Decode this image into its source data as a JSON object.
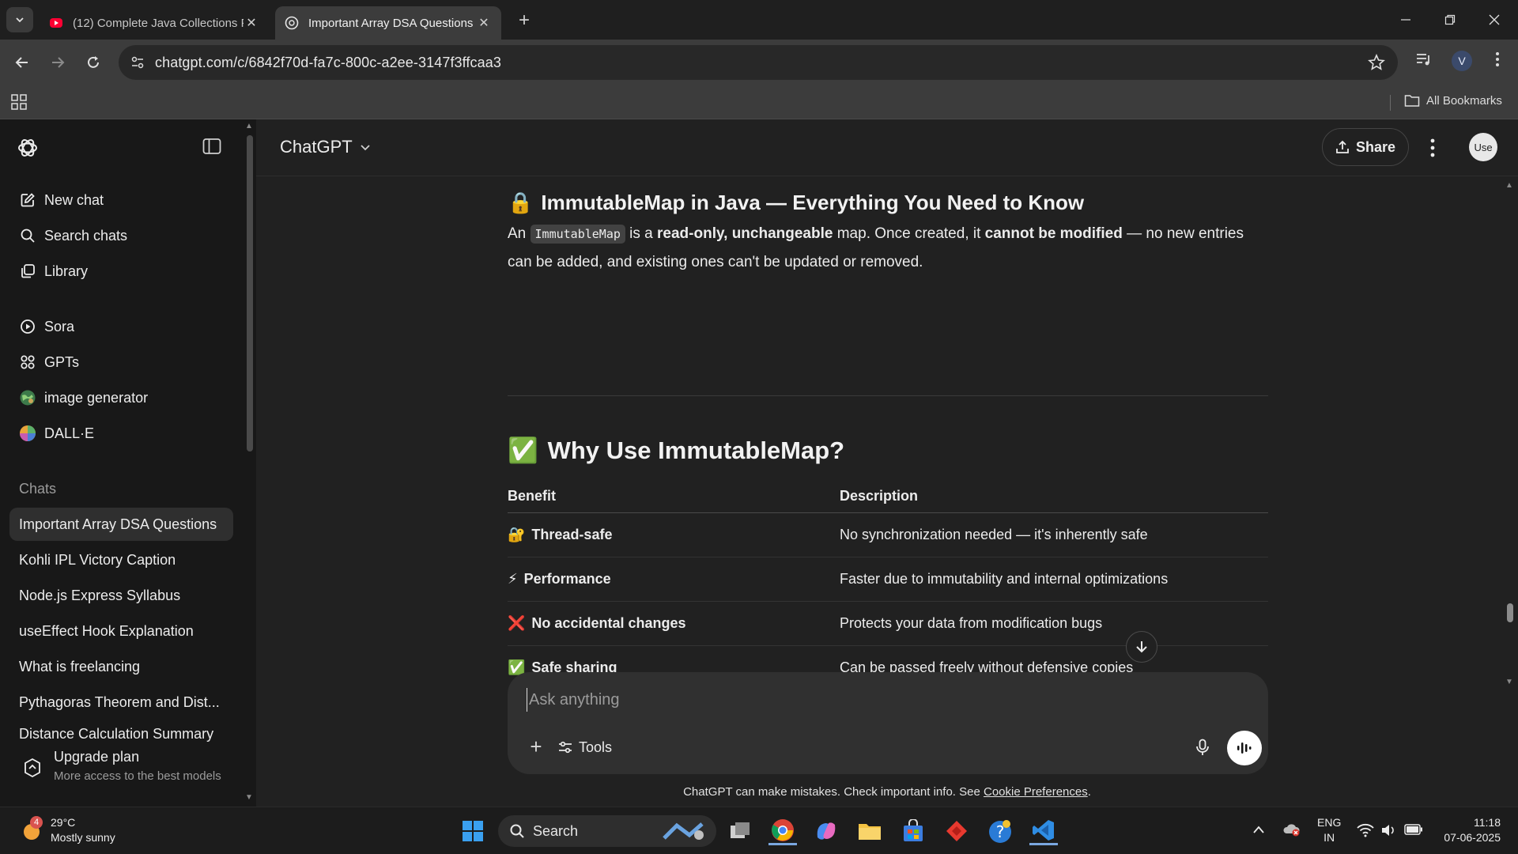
{
  "browser": {
    "tabs": [
      {
        "title": "(12) Complete Java Collections F",
        "active": false
      },
      {
        "title": "Important Array DSA Questions",
        "active": true
      }
    ],
    "url": "chatgpt.com/c/6842f70d-fa7c-800c-a2ee-3147f3ffcaa3",
    "profile_initial": "V",
    "all_bookmarks": "All Bookmarks"
  },
  "sidebar": {
    "nav": [
      {
        "label": "New chat",
        "icon": "edit-icon"
      },
      {
        "label": "Search chats",
        "icon": "search-icon"
      },
      {
        "label": "Library",
        "icon": "library-icon"
      },
      {
        "label": "Sora",
        "icon": "play-circle-icon"
      },
      {
        "label": "GPTs",
        "icon": "grid-dots-icon"
      },
      {
        "label": "image generator",
        "icon": "globe-icon"
      },
      {
        "label": "DALL·E",
        "icon": "dalle-icon"
      }
    ],
    "chats_heading": "Chats",
    "chats": [
      "Important Array DSA Questions",
      "Kohli IPL Victory Caption",
      "Node.js Express Syllabus",
      "useEffect Hook Explanation",
      "What is freelancing",
      "Pythagoras Theorem and Dist...",
      "Distance Calculation Summary"
    ],
    "upgrade": {
      "title": "Upgrade plan",
      "subtitle": "More access to the best models"
    }
  },
  "header": {
    "model": "ChatGPT",
    "share": "Share",
    "avatar_text": "Use"
  },
  "content": {
    "section1": {
      "emoji": "🔒",
      "title": "ImmutableMap in Java — Everything You Need to Know",
      "p_an": "An ",
      "p_code": "ImmutableMap",
      "p_is": " is a ",
      "p_b1": "read-only, unchangeable",
      "p_mid": " map. Once created, it ",
      "p_b2": "cannot be modified",
      "p_end": " — no new entries can be added, and existing ones can't be updated or removed."
    },
    "section2": {
      "emoji": "✅",
      "title": "Why Use ImmutableMap?"
    },
    "table": {
      "headers": [
        "Benefit",
        "Description"
      ],
      "rows": [
        {
          "icon": "🔐",
          "benefit": "Thread-safe",
          "description": "No synchronization needed — it's inherently safe"
        },
        {
          "icon": "⚡",
          "benefit": "Performance",
          "description": "Faster due to immutability and internal optimizations"
        },
        {
          "icon": "❌",
          "benefit": "No accidental changes",
          "description": "Protects your data from modification bugs"
        },
        {
          "icon": "✅",
          "benefit": "Safe sharing",
          "description": "Can be passed freely without defensive copies"
        }
      ]
    }
  },
  "composer": {
    "placeholder": "Ask anything",
    "tools": "Tools"
  },
  "disclaimer": {
    "text": "ChatGPT can make mistakes. Check important info. See ",
    "link": "Cookie Preferences",
    "end": "."
  },
  "taskbar": {
    "weather_badge": "4",
    "temperature": "29°C",
    "condition": "Mostly sunny",
    "search": "Search",
    "lang1": "ENG",
    "lang2": "IN",
    "time": "11:18",
    "date": "07-06-2025"
  },
  "colors": {
    "main_bg": "#212121",
    "sidebar_bg": "#181818",
    "composer_bg": "#303030",
    "accent_check": "#2fb66a"
  }
}
